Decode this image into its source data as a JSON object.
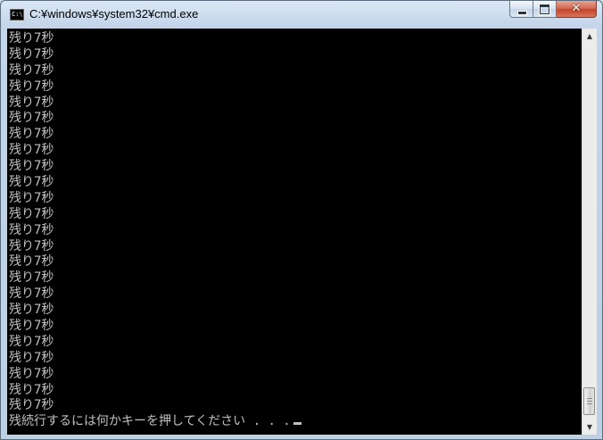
{
  "window": {
    "title": "C:¥windows¥system32¥cmd.exe",
    "icon_label": "C:\\",
    "icon": "console-app-icon",
    "minimize_icon": "minimize-icon",
    "maximize_icon": "maximize-icon",
    "close_icon": "close-icon",
    "close_glyph": "✕"
  },
  "console": {
    "background": "#000000",
    "text_color": "#c0c0c0",
    "lines": [
      "残り7秒",
      "残り7秒",
      "残り7秒",
      "残り7秒",
      "残り7秒",
      "残り7秒",
      "残り7秒",
      "残り7秒",
      "残り7秒",
      "残り7秒",
      "残り7秒",
      "残り7秒",
      "残り7秒",
      "残り7秒",
      "残り7秒",
      "残り7秒",
      "残り7秒",
      "残り7秒",
      "残り7秒",
      "残り7秒",
      "残り7秒",
      "残り7秒",
      "残り7秒",
      "残り7秒"
    ],
    "prompt": "残続行するには何かキーを押してください . . ."
  },
  "scrollbar": {
    "up_arrow": "▲",
    "down_arrow": "▼",
    "position": 0.95
  }
}
